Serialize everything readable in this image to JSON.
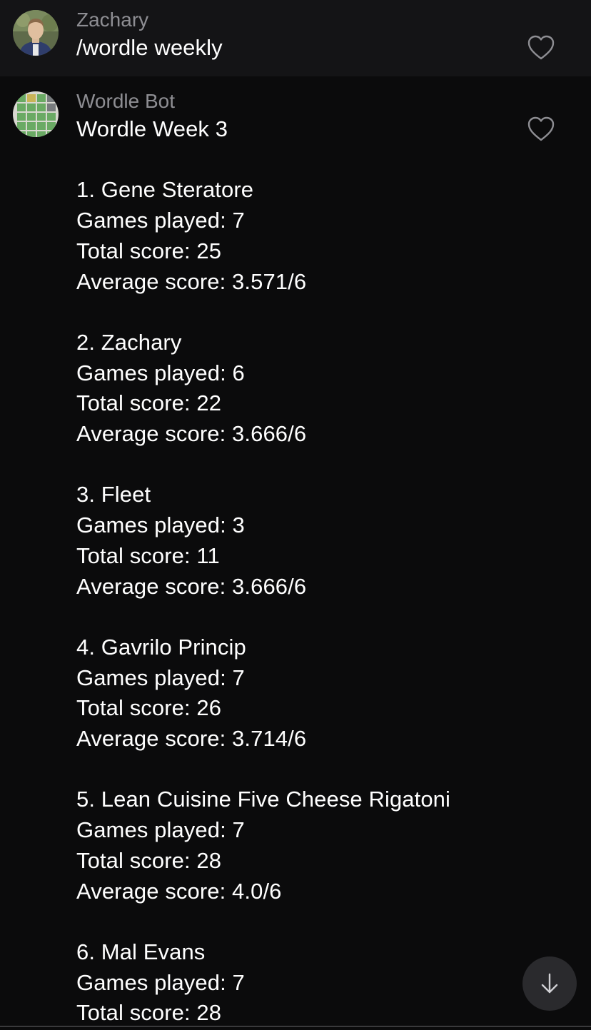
{
  "messages": [
    {
      "sender": "Zachary",
      "text": "/wordle weekly",
      "avatar_icon": "user-photo-avatar",
      "like_icon": "heart-outline-icon"
    },
    {
      "sender": "Wordle Bot",
      "avatar_icon": "wordle-grid-avatar",
      "like_icon": "heart-outline-icon",
      "text": "Wordle Week 3\n\n1. Gene Steratore\nGames played: 7\nTotal score: 25\nAverage score: 3.571/6\n\n2. Zachary\nGames played: 6\nTotal score: 22\nAverage score: 3.666/6\n\n3. Fleet\nGames played: 3\nTotal score: 11\nAverage score: 3.666/6\n\n4. Gavrilo Princip\nGames played: 7\nTotal score: 26\nAverage score: 3.714/6\n\n5. Lean Cuisine Five Cheese Rigatoni\nGames played: 7\nTotal score: 28\nAverage score: 4.0/6\n\n6. Mal Evans\nGames played: 7\nTotal score: 28"
    }
  ],
  "scroll_button": {
    "icon": "arrow-down-icon"
  },
  "colors": {
    "background": "#0b0b0c",
    "highlight_row": "#141416",
    "sender_name": "#8e8e93",
    "message_text": "#ffffff",
    "icon_stroke": "#8e8e93",
    "wordle_green": "#6aaa64",
    "wordle_tile_text": "#ffffff"
  }
}
